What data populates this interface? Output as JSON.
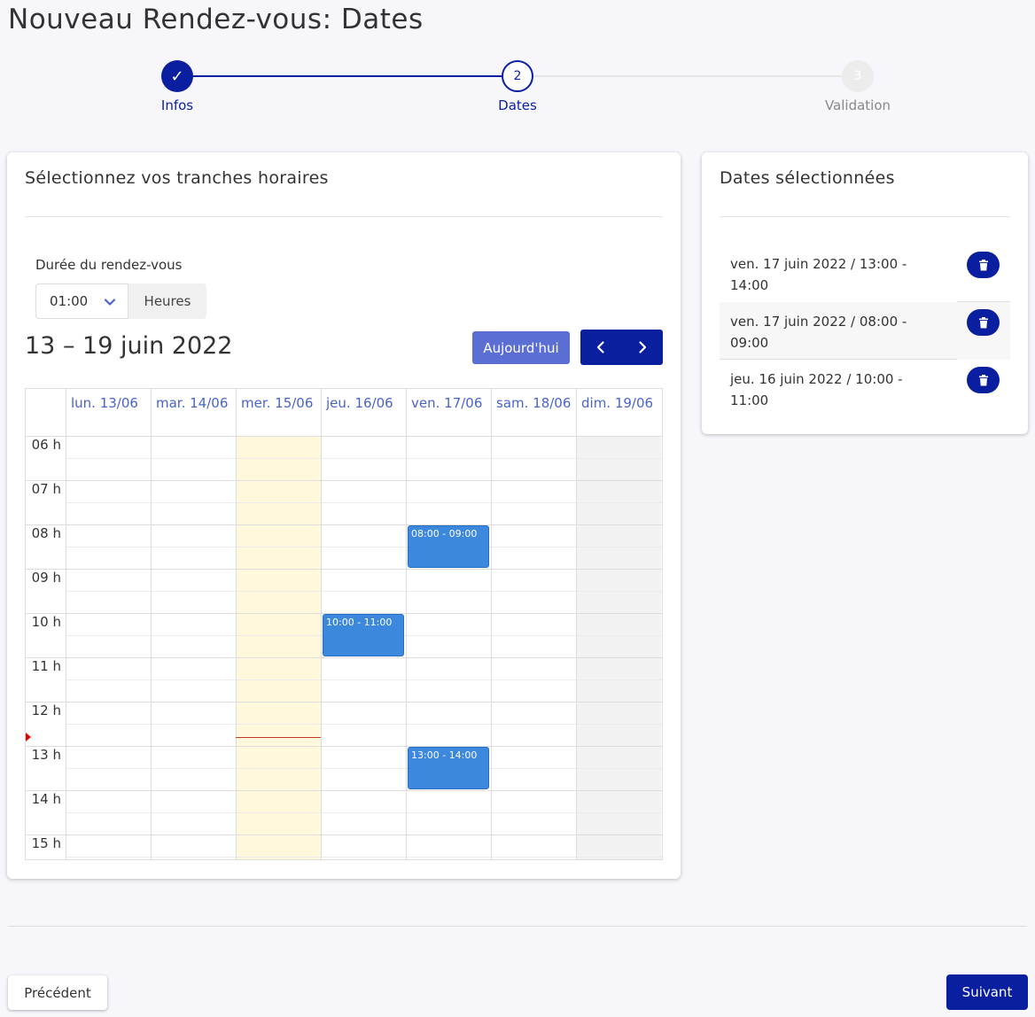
{
  "page_title": "Nouveau Rendez-vous: Dates",
  "stepper": {
    "steps": [
      {
        "label": "Infos",
        "number": "✓",
        "state": "completed"
      },
      {
        "label": "Dates",
        "number": "2",
        "state": "active"
      },
      {
        "label": "Validation",
        "number": "3",
        "state": "pending"
      }
    ]
  },
  "slots_card": {
    "title": "Sélectionnez vos tranches horaires",
    "duration_label": "Durée du rendez-vous",
    "duration_value": "01:00",
    "duration_unit": "Heures",
    "range_title": "13 – 19 juin 2022",
    "today_label": "Aujourd'hui"
  },
  "calendar": {
    "days": [
      {
        "label": "lun. 13/06",
        "style": "normal"
      },
      {
        "label": "mar. 14/06",
        "style": "normal"
      },
      {
        "label": "mer. 15/06",
        "style": "today"
      },
      {
        "label": "jeu. 16/06",
        "style": "normal"
      },
      {
        "label": "ven. 17/06",
        "style": "normal"
      },
      {
        "label": "sam. 18/06",
        "style": "normal"
      },
      {
        "label": "dim. 19/06",
        "style": "disabled"
      }
    ],
    "hours": [
      "06 h",
      "07 h",
      "08 h",
      "09 h",
      "10 h",
      "11 h",
      "12 h",
      "13 h",
      "14 h",
      "15 h"
    ],
    "first_hour": 6,
    "now_hour": 12.8,
    "now_day": 2,
    "events": [
      {
        "day": 4,
        "start": 8,
        "end": 9,
        "label": "08:00 - 09:00"
      },
      {
        "day": 3,
        "start": 10,
        "end": 11,
        "label": "10:00 - 11:00"
      },
      {
        "day": 4,
        "start": 13,
        "end": 14,
        "label": "13:00 - 14:00"
      }
    ]
  },
  "selected_card": {
    "title": "Dates sélectionnées",
    "items": [
      {
        "text": "ven. 17 juin 2022 / 13:00 - 14:00"
      },
      {
        "text": "ven. 17 juin 2022 / 08:00 - 09:00"
      },
      {
        "text": "jeu. 16 juin 2022 / 10:00 - 11:00"
      }
    ]
  },
  "footer": {
    "prev_label": "Précédent",
    "next_label": "Suivant"
  },
  "colors": {
    "primary": "#0a1fa0",
    "accent": "#5a6ed3",
    "event": "#3c88dc",
    "today_bg": "#fff8dd",
    "disabled_bg": "#f2f2f2"
  }
}
